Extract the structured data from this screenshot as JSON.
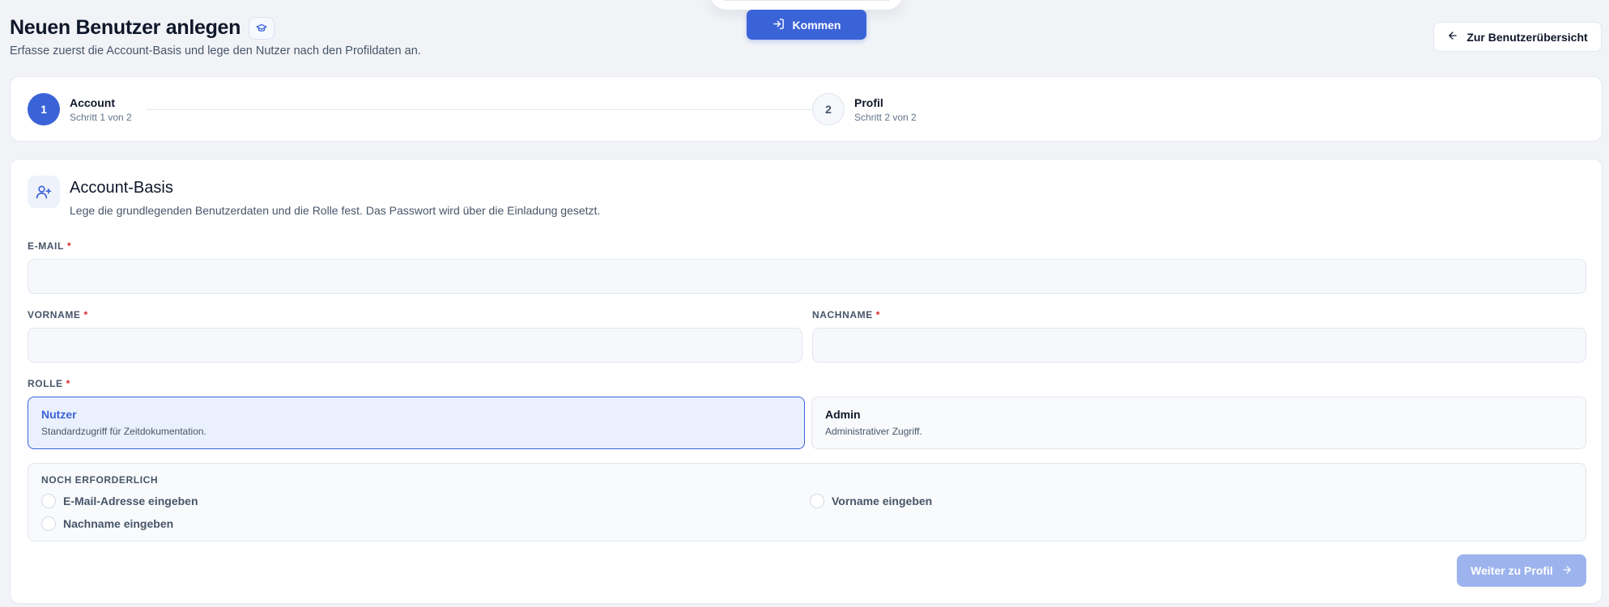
{
  "header": {
    "title": "Neuen Benutzer anlegen",
    "title_icon": "graduation-cap-icon",
    "subtitle": "Erfasse zuerst die Account-Basis und lege den Nutzer nach den Profildaten an.",
    "kommen_label": "Kommen",
    "kommen_icon": "sign-in-icon",
    "back_label": "Zur Benutzerübersicht",
    "back_icon": "arrow-left-icon"
  },
  "stepper": {
    "steps": [
      {
        "number": "1",
        "title": "Account",
        "subtitle": "Schritt 1 von 2",
        "active": true
      },
      {
        "number": "2",
        "title": "Profil",
        "subtitle": "Schritt 2 von 2",
        "active": false
      }
    ]
  },
  "section": {
    "icon": "user-plus-icon",
    "title": "Account-Basis",
    "description": "Lege die grundlegenden Benutzerdaten und die Rolle fest. Das Passwort wird über die Einladung gesetzt."
  },
  "form": {
    "email_label": "E-MAIL",
    "email_value": "",
    "firstname_label": "VORNAME",
    "firstname_value": "",
    "lastname_label": "NACHNAME",
    "lastname_value": "",
    "required_marker": "*",
    "role_label": "ROLLE",
    "roles": [
      {
        "title": "Nutzer",
        "description": "Standardzugriff für Zeitdokumentation.",
        "selected": true
      },
      {
        "title": "Admin",
        "description": "Administrativer Zugriff.",
        "selected": false
      }
    ]
  },
  "requirements": {
    "title": "NOCH ERFORDERLICH",
    "items": [
      "E-Mail-Adresse eingeben",
      "Vorname eingeben",
      "Nachname eingeben"
    ]
  },
  "actions": {
    "next_label": "Weiter zu Profil",
    "next_icon": "arrow-right-icon"
  },
  "colors": {
    "accent": "#3b63d8",
    "accent_light": "#eaf0fd",
    "required": "#dc2626",
    "disabled_button": "#9db3ee"
  }
}
